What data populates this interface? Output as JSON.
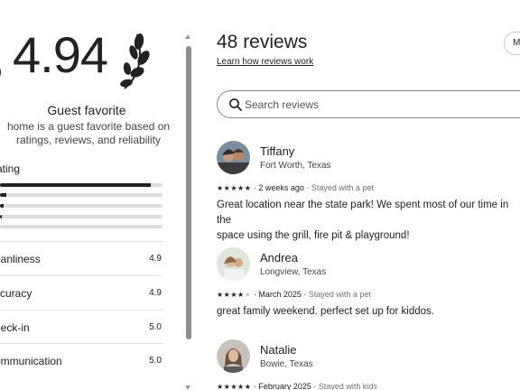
{
  "summary": {
    "rating": "4.94",
    "badge_title": "Guest favorite",
    "badge_description": "home is a guest favorite based on ratings, reviews, and reliability",
    "overall_label": "ating",
    "distribution": [
      0.93,
      0.04,
      0.02,
      0.01,
      0.0
    ],
    "categories": [
      {
        "name": "eanliness",
        "score": "4.9"
      },
      {
        "name": "ccuracy",
        "score": "4.9"
      },
      {
        "name": "neck-in",
        "score": "5.0"
      },
      {
        "name": "ommunication",
        "score": "5.0"
      }
    ]
  },
  "reviews_panel": {
    "title": "48 reviews",
    "learn_link": "Learn how reviews work",
    "sort_button_label": "M",
    "search": {
      "placeholder": "Search reviews",
      "value": ""
    },
    "icons": {
      "search": "search-icon",
      "laurel": "laurel-icon",
      "star": "star-icon"
    }
  },
  "reviews": [
    {
      "name": "Tiffany",
      "location": "Fort Worth, Texas",
      "stars": 5,
      "when": "2 weeks ago",
      "trip": "Stayed with a pet",
      "text": "Great location near the state park! We spent most of our time in the\nspace using the grill, fire pit & playground!"
    },
    {
      "name": "Andrea",
      "location": "Longview, Texas",
      "stars": 4,
      "when": "March 2025",
      "trip": "Stayed with a pet",
      "text": "great family weekend.  perfect set up for kiddos."
    },
    {
      "name": "Natalie",
      "location": "Bowie, Texas",
      "stars": 5,
      "when": "February 2025",
      "trip": "Stayed with kids",
      "text": ""
    }
  ],
  "colors": {
    "text": "#222222",
    "muted": "#717171",
    "bar_track": "#dddddd",
    "bar_fill": "#222222",
    "border": "#e4e4e4"
  }
}
